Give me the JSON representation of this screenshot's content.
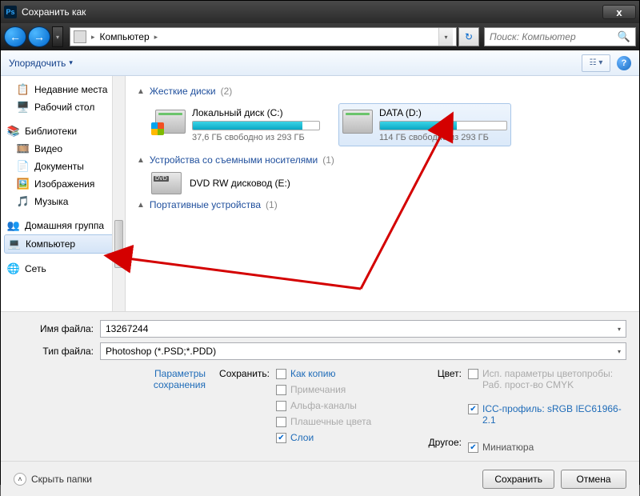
{
  "window": {
    "title": "Сохранить как"
  },
  "nav": {
    "breadcrumb": "Компьютер",
    "search_placeholder": "Поиск: Компьютер"
  },
  "toolbar": {
    "organize": "Упорядочить"
  },
  "sidebar": {
    "recent": "Недавние места",
    "desktop": "Рабочий стол",
    "libraries": "Библиотеки",
    "video": "Видео",
    "documents": "Документы",
    "images": "Изображения",
    "music": "Музыка",
    "homegroup": "Домашняя группа",
    "computer": "Компьютер",
    "network": "Сеть"
  },
  "groups": {
    "hdd": {
      "title": "Жесткие диски",
      "count": "(2)"
    },
    "removable": {
      "title": "Устройства со съемными носителями",
      "count": "(1)"
    },
    "portable": {
      "title": "Портативные устройства",
      "count": "(1)"
    }
  },
  "drives": {
    "c": {
      "name": "Локальный диск (C:)",
      "free": "37,6 ГБ свободно из 293 ГБ",
      "fill_pct": 87
    },
    "d": {
      "name": "DATA (D:)",
      "free": "114 ГБ свободно из 293 ГБ",
      "fill_pct": 61
    }
  },
  "dvd": {
    "name": "DVD RW дисковод (E:)"
  },
  "fields": {
    "filename_label": "Имя файла:",
    "filename_value": "13267244",
    "filetype_label": "Тип файла:",
    "filetype_value": "Photoshop (*.PSD;*.PDD)"
  },
  "options": {
    "save_params": "Параметры сохранения",
    "save_label": "Сохранить:",
    "as_copy": "Как копию",
    "notes": "Примечания",
    "alpha": "Альфа-каналы",
    "spot": "Плашечные цвета",
    "layers": "Слои",
    "color_label": "Цвет:",
    "proof": "Исп. параметры цветопробы: Раб. прост-во CMYK",
    "icc": "ICC-профиль: sRGB IEC61966-2.1",
    "other_label": "Другое:",
    "thumbnail": "Миниатюра"
  },
  "footer": {
    "hide": "Скрыть папки",
    "save": "Сохранить",
    "cancel": "Отмена"
  }
}
